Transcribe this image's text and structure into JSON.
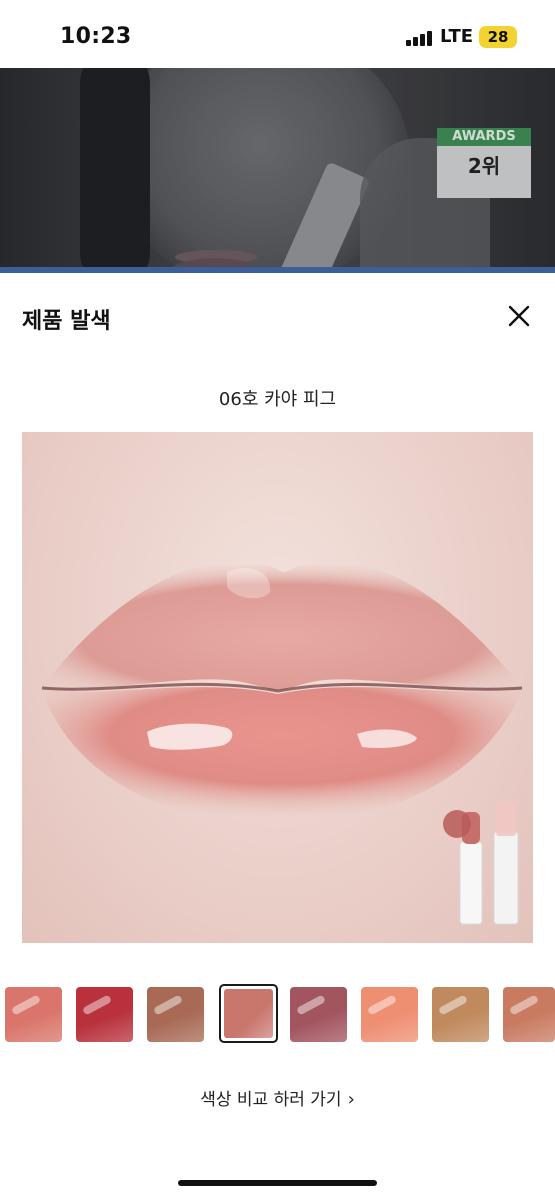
{
  "status_bar": {
    "time": "10:23",
    "network": "LTE",
    "battery": "28",
    "battery_color": "#f3d330"
  },
  "banner": {
    "award_title": "AWARDS",
    "award_rank": "2위"
  },
  "sheet": {
    "title": "제품 발색",
    "close_icon": "close-icon",
    "shade_name": "06호 카야 피그",
    "compare_label": "색상 비교 하러 가기",
    "compare_chevron": "›"
  },
  "swatches": [
    {
      "color": "#d9756a",
      "selected": false
    },
    {
      "color": "#b8313c",
      "selected": false
    },
    {
      "color": "#a86a55",
      "selected": false
    },
    {
      "color": "#c9766d",
      "selected": true
    },
    {
      "color": "#a2545f",
      "selected": false
    },
    {
      "color": "#ee8f72",
      "selected": false
    },
    {
      "color": "#c08a5e",
      "selected": false
    },
    {
      "color": "#c97b62",
      "selected": false
    }
  ],
  "colors": {
    "accent_bar": "#3c5f9c",
    "award_green": "#3d8a55"
  }
}
